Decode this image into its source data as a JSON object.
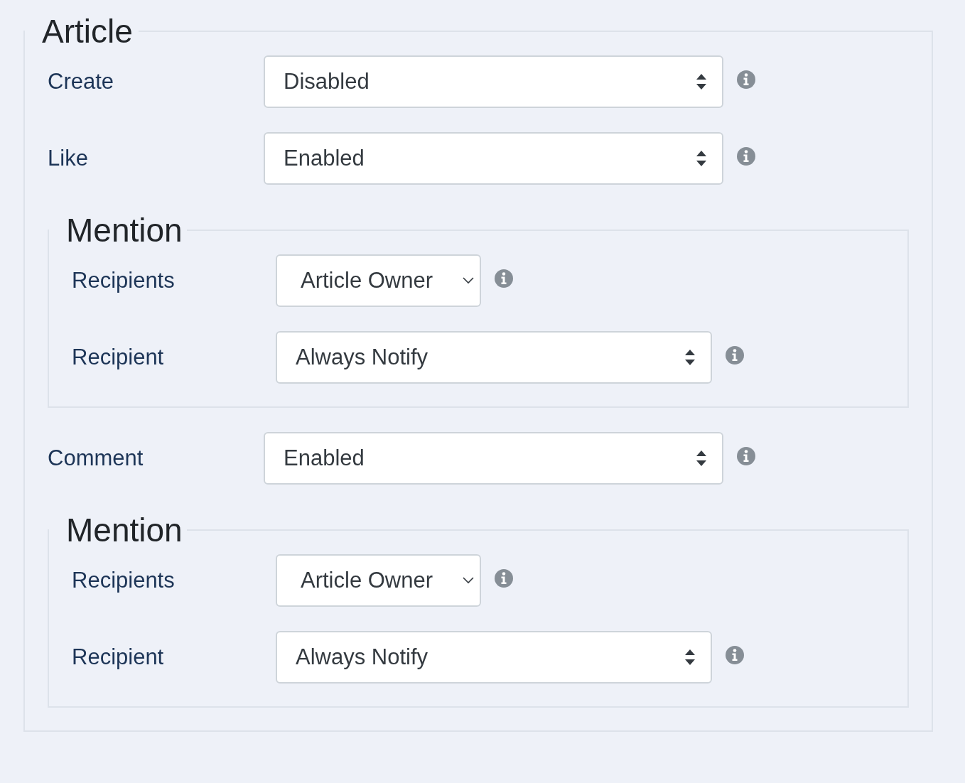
{
  "legend": "Article",
  "items": [
    {
      "kind": "field",
      "label": "Create",
      "select": {
        "kind": "stepper",
        "value": "Disabled"
      }
    },
    {
      "kind": "field",
      "label": "Like",
      "select": {
        "kind": "stepper",
        "value": "Enabled"
      }
    },
    {
      "kind": "group",
      "legend": "Mention",
      "items": [
        {
          "kind": "field",
          "label": "Recipients",
          "select": {
            "kind": "dropdown",
            "value": "Article Owner"
          }
        },
        {
          "kind": "field",
          "label": "Recipient",
          "select": {
            "kind": "stepper",
            "value": "Always Notify"
          }
        }
      ]
    },
    {
      "kind": "field",
      "label": "Comment",
      "select": {
        "kind": "stepper",
        "value": "Enabled"
      }
    },
    {
      "kind": "group",
      "legend": "Mention",
      "items": [
        {
          "kind": "field",
          "label": "Recipients",
          "select": {
            "kind": "dropdown",
            "value": "Article Owner"
          }
        },
        {
          "kind": "field",
          "label": "Recipient",
          "select": {
            "kind": "stepper",
            "value": "Always Notify"
          }
        }
      ]
    }
  ]
}
